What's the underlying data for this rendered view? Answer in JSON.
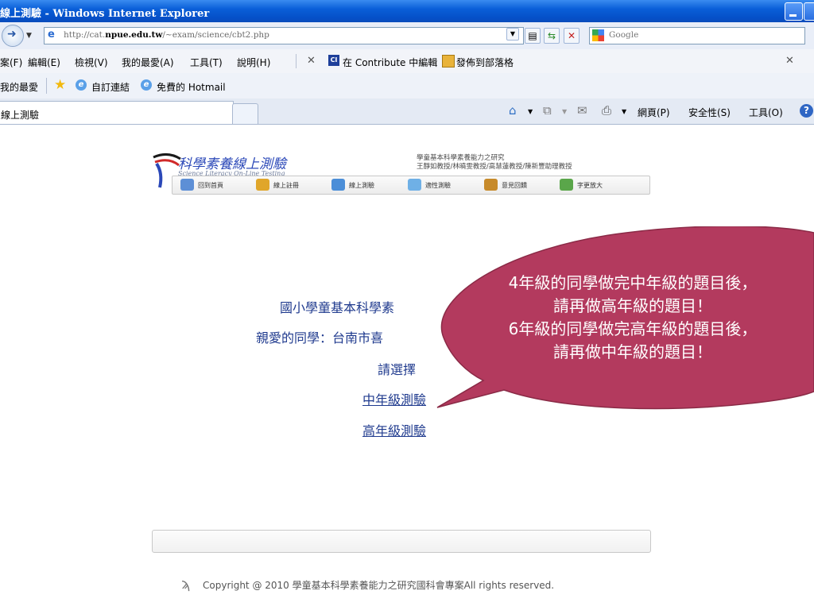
{
  "window": {
    "title": "線上測驗 - Windows Internet Explorer"
  },
  "address": {
    "url_prefix": "http://cat.",
    "url_host": "npue.edu.tw",
    "url_path": "/~exam/science/cbt2.php",
    "search_placeholder": "Google"
  },
  "menu": {
    "file": "案(F)",
    "edit": "編輯(E)",
    "view": "檢視(V)",
    "favorites": "我的最愛(A)",
    "tools": "工具(T)",
    "help": "說明(H)",
    "contribute_edit": "在 Contribute 中編輯",
    "publish_blog": "發佈到部落格"
  },
  "favbar": {
    "favorites": "我的最愛",
    "custom_links": "自訂連結",
    "hotmail": "免費的 Hotmail"
  },
  "tabs": [
    {
      "label": "線上測驗"
    }
  ],
  "commands": {
    "page": "網頁(P)",
    "safety": "安全性(S)",
    "tools": "工具(O)",
    "help_glyph": "?"
  },
  "header": {
    "logo_title": "科學素養線上測驗",
    "logo_subtitle": "Science Literacy On-Line Testing",
    "research_line1": "學童基本科學素養能力之研究",
    "research_line2": "王靜如教授/林曉雯教授/高慧蓮教授/陳新豐助理教授",
    "nav": [
      "回到首頁",
      "線上註冊",
      "線上測驗",
      "適性測驗",
      "意見回饋",
      "字更放大"
    ]
  },
  "main": {
    "title": "國小學童基本科學素",
    "greeting": "親愛的同學：台南市喜",
    "select_label": "請選擇",
    "mid_grade_link": "中年級測驗",
    "high_grade_link": "高年級測驗"
  },
  "callout": {
    "line1": "4年級的同學做完中年級的題目後，",
    "line2": "請再做高年級的題目！",
    "line3": "6年級的同學做完高年級的題目後，",
    "line4": "請再做中年級的題目！",
    "color": "#b33a5e"
  },
  "footer": {
    "copyright": "Copyright @ 2010 學童基本科學素養能力之研究國科會專案All rights reserved."
  }
}
